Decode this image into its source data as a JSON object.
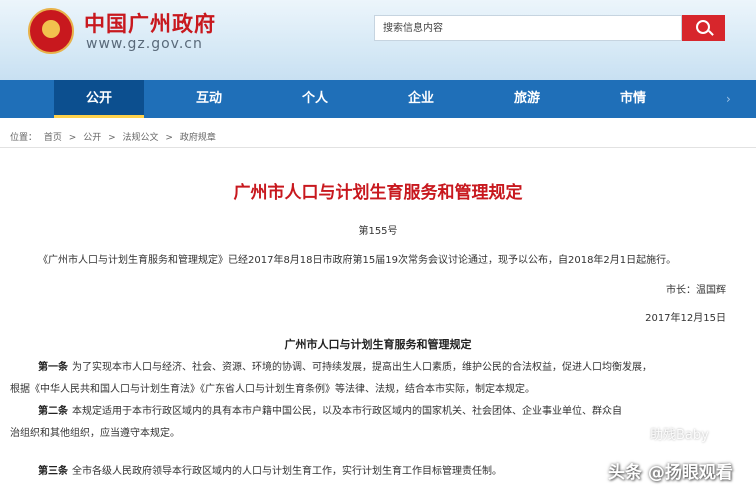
{
  "header": {
    "site_name": "中国广州政府",
    "site_domain": "www.gz.gov.cn",
    "search_placeholder": "搜索信息内容"
  },
  "nav": {
    "items": [
      {
        "label": "公开"
      },
      {
        "label": "互动"
      },
      {
        "label": "个人"
      },
      {
        "label": "企业"
      },
      {
        "label": "旅游"
      },
      {
        "label": "市情"
      }
    ],
    "active": "公开",
    "more": "›"
  },
  "breadcrumb": {
    "prefix": "位置：",
    "items": [
      "首页",
      "公开",
      "法规公文",
      "政府规章"
    ],
    "separator": ">"
  },
  "article": {
    "title": "广州市人口与计划生育服务和管理规定",
    "order_no": "第155号",
    "notice": "《广州市人口与计划生育服务和管理规定》已经2017年8月18日市政府第15届19次常务会议讨论通过，现予以公布，自2018年2月1日起施行。",
    "mayor": "市长：温国辉",
    "date": "2017年12月15日",
    "subtitle": "广州市人口与计划生育服务和管理规定",
    "p1_label": "第一条",
    "p1_line1": "为了实现本市人口与经济、社会、资源、环境的协调、可持续发展，提高出生人口素质，维护公民的合法权益，促进人口均衡发展，",
    "p1_line2": "根据《中华人民共和国人口与计划生育法》《广东省人口与计划生育条例》等法律、法规，结合本市实际，制定本规定。",
    "p2_label": "第二条",
    "p2_line1": "本规定适用于本市行政区域内的具有本市户籍中国公民，以及本市行政区域内的国家机关、社会团体、企业事业单位、群众自",
    "p2_line2": "治组织和其他组织，应当遵守本规定。",
    "p3_label": "第三条",
    "p3_line1": "全市各级人民政府领导本行政区域内的人口与计划生育工作，实行计划生育工作目标管理责任制。"
  },
  "watermark": {
    "small": "助残Baby",
    "brand": "头条 @扬眼观看"
  },
  "colors": {
    "brand_red": "#c8181e",
    "nav_blue": "#1f6fb8",
    "nav_active": "#0c4f8f"
  }
}
